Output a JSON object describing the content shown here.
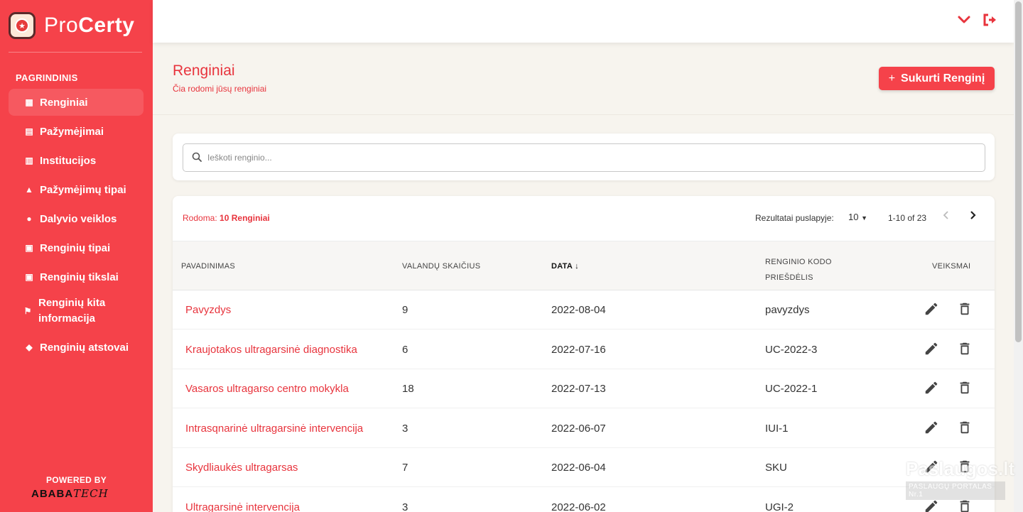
{
  "app": {
    "logo_text_a": "Pro",
    "logo_text_b": "Certy",
    "accent": "#f5424a"
  },
  "sidebar": {
    "section": "PAGRINDINIS",
    "items": [
      {
        "label": "Renginiai",
        "icon": "calendar-icon",
        "active": true
      },
      {
        "label": "Pažymėjimai",
        "icon": "document-icon"
      },
      {
        "label": "Institucijos",
        "icon": "building-icon"
      },
      {
        "label": "Pažymėjimų tipai",
        "icon": "stamp-icon"
      },
      {
        "label": "Dalyvio veiklos",
        "icon": "user-check-icon"
      },
      {
        "label": "Renginių tipai",
        "icon": "calendar-check-icon"
      },
      {
        "label": "Renginių tikslai",
        "icon": "calendar-plus-icon"
      },
      {
        "label": "Renginių kita informacija",
        "icon": "flag-checkered-icon"
      },
      {
        "label": "Renginių atstovai",
        "icon": "user-tie-icon"
      }
    ],
    "powered_by": "POWERED BY",
    "brand_a": "ABABA",
    "brand_b": "TECH"
  },
  "topbar": {
    "dropdown_icon": "chevron-down-icon",
    "logout_icon": "logout-icon"
  },
  "header": {
    "title": "Renginiai",
    "subtitle": "Čia rodomi jūsų renginiai",
    "create_button": "Sukurti Renginį"
  },
  "search": {
    "placeholder": "Ieškoti renginio...",
    "value": ""
  },
  "table": {
    "showing_prefix": "Rodoma:",
    "showing_value": "10 Renginiai",
    "rows_per_page_label": "Rezultatai puslapyje:",
    "rows_per_page_value": "10",
    "range": "1-10 of 23",
    "columns": {
      "name": "PAVADINIMAS",
      "hours": "VALANDŲ SKAIČIUS",
      "date": "DATA",
      "code_line1": "RENGINIO KODO",
      "code_line2": "PRIEŠDĖLIS",
      "actions": "VEIKSMAI"
    },
    "rows": [
      {
        "name": "Pavyzdys",
        "hours": "9",
        "date": "2022-08-04",
        "code": "pavyzdys"
      },
      {
        "name": "Kraujotakos ultragarsinė diagnostika",
        "hours": "6",
        "date": "2022-07-16",
        "code": "UC-2022-3"
      },
      {
        "name": "Vasaros ultragarso centro mokykla",
        "hours": "18",
        "date": "2022-07-13",
        "code": "UC-2022-1"
      },
      {
        "name": "Intrasqnarinė ultragarsinė intervencija",
        "hours": "3",
        "date": "2022-06-07",
        "code": "IUI-1"
      },
      {
        "name": "Skydliaukės ultragarsas",
        "hours": "7",
        "date": "2022-06-04",
        "code": "SKU"
      },
      {
        "name": "Ultragarsinė intervencija",
        "hours": "3",
        "date": "2022-06-02",
        "code": "UGI-2"
      }
    ]
  },
  "watermark": {
    "line1": "Paslaugos.lt",
    "line2": "PASLAUGŲ PORTALAS Nr.1"
  }
}
